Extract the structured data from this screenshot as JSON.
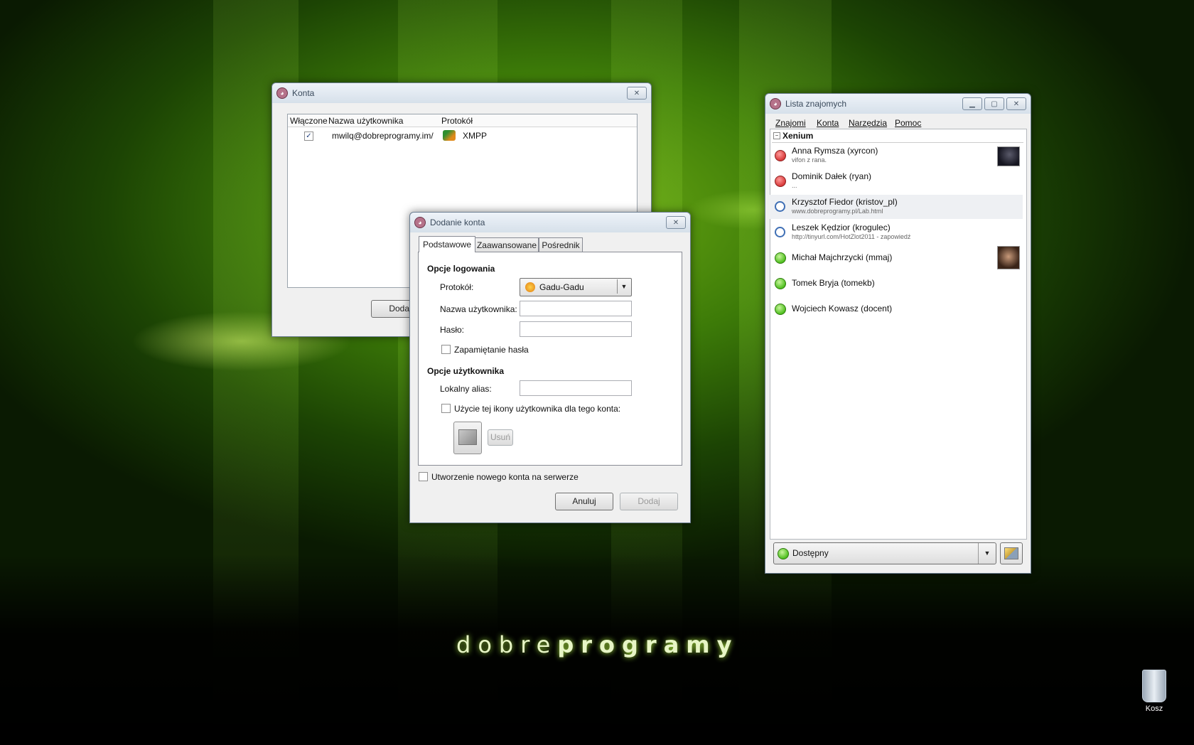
{
  "desktop": {
    "brand_light": "dobre",
    "brand_bold": "programy",
    "trash_label": "Kosz"
  },
  "konta": {
    "title": "Konta",
    "columns": [
      "Włączone",
      "Nazwa użytkownika",
      "Protokół"
    ],
    "rows": [
      {
        "enabled": true,
        "username": "mwilq@dobreprogramy.im/",
        "protocol": "XMPP"
      }
    ],
    "add_button": "Dodaj"
  },
  "dodanie": {
    "title": "Dodanie konta",
    "tabs": [
      "Podstawowe",
      "Zaawansowane",
      "Pośrednik"
    ],
    "login_section": "Opcje logowania",
    "protocol_label": "Protokół:",
    "protocol_value": "Gadu-Gadu",
    "username_label": "Nazwa użytkownika:",
    "password_label": "Hasło:",
    "remember_label": "Zapamiętanie hasła",
    "user_section": "Opcje użytkownika",
    "alias_label": "Lokalny alias:",
    "use_icon_label": "Użycie tej ikony użytkownika dla tego konta:",
    "remove_button": "Usuń",
    "create_label": "Utworzenie nowego konta na serwerze",
    "cancel_button": "Anuluj",
    "add_button": "Dodaj"
  },
  "lista": {
    "title": "Lista znajomych",
    "menu": [
      "Znajomi",
      "Konta",
      "Narzędzia",
      "Pomoc"
    ],
    "group": "Xenium",
    "contacts": [
      {
        "name": "Anna Rymsza (xyrcon)",
        "status": "vifon z rana.",
        "state": "busy"
      },
      {
        "name": "Dominik Dałek (ryan)",
        "status": "...",
        "state": "busy"
      },
      {
        "name": "Krzysztof Fiedor (kristov_pl)",
        "status": "www.dobreprogramy.pl/Lab.html",
        "state": "away"
      },
      {
        "name": "Leszek Kędzior (krogulec)",
        "status": "http://tinyurl.com/HotZlot2011 - zapowiedź",
        "state": "away"
      },
      {
        "name": "Michał Majchrzycki (mmaj)",
        "status": "",
        "state": "online"
      },
      {
        "name": "Tomek Bryja (tomekb)",
        "status": "",
        "state": "online"
      },
      {
        "name": "Wojciech Kowasz (docent)",
        "status": "",
        "state": "online"
      }
    ],
    "status_value": "Dostępny"
  },
  "colors": {
    "online": "#4fbf1f",
    "busy": "#d83a3a",
    "away": "#3f6fb5"
  }
}
